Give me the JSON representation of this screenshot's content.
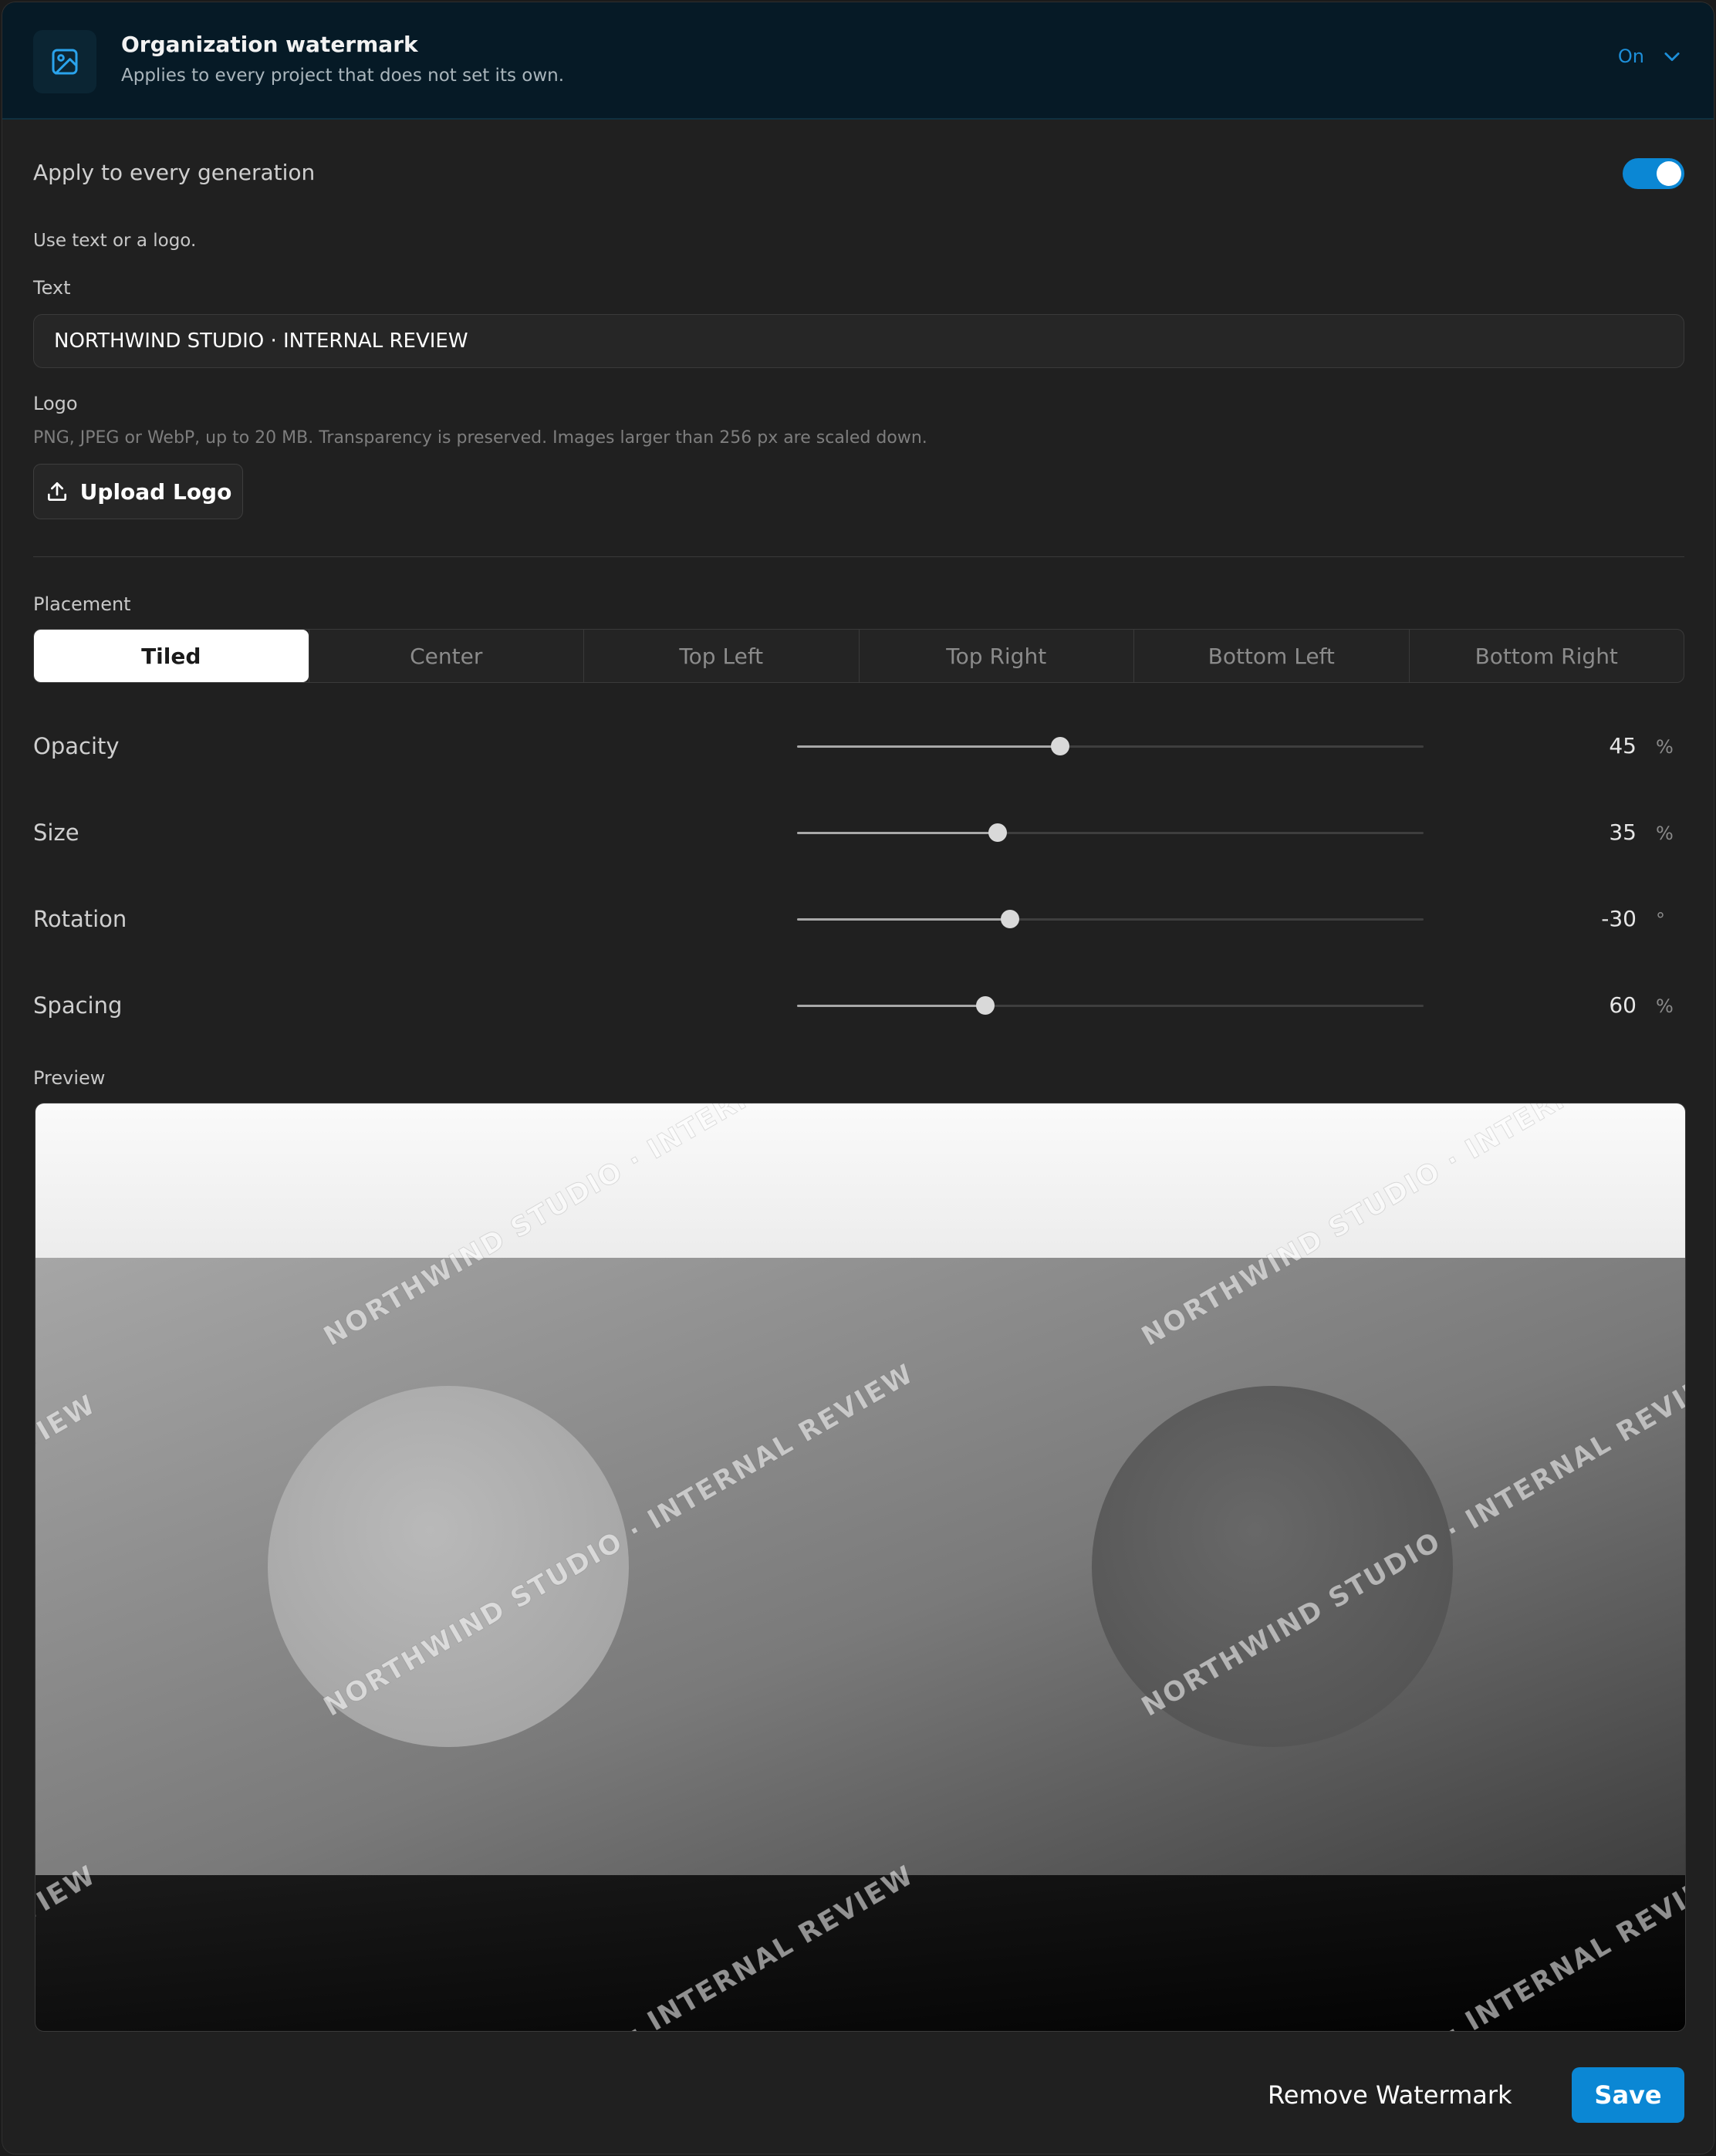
{
  "header": {
    "title": "Organization watermark",
    "subtitle": "Applies to every project that does not set its own.",
    "state": "On",
    "icon": "image-icon",
    "accent": "#0b87d4"
  },
  "apply_all": {
    "label": "Apply to every generation",
    "enabled": true
  },
  "hint": "Use text or a logo.",
  "text_field": {
    "label": "Text",
    "value": "NORTHWIND STUDIO · INTERNAL REVIEW"
  },
  "logo": {
    "label": "Logo",
    "help": "PNG, JPEG or WebP, up to 20 MB. Transparency is preserved. Images larger than 256 px are scaled down.",
    "upload_label": "Upload Logo"
  },
  "placement": {
    "label": "Placement",
    "options": [
      "Tiled",
      "Center",
      "Top Left",
      "Top Right",
      "Bottom Left",
      "Bottom Right"
    ],
    "selected": "Tiled"
  },
  "sliders": [
    {
      "label": "Opacity",
      "value": "45",
      "unit": "%",
      "fraction": 0.42
    },
    {
      "label": "Size",
      "value": "35",
      "unit": "%",
      "fraction": 0.32
    },
    {
      "label": "Rotation",
      "value": "-30",
      "unit": "°",
      "fraction": 0.34
    },
    {
      "label": "Spacing",
      "value": "60",
      "unit": "%",
      "fraction": 0.3
    }
  ],
  "preview": {
    "label": "Preview",
    "watermark_text": "NORTHWIND STUDIO · INTERNAL REVIEW"
  },
  "actions": {
    "remove_label": "Remove Watermark",
    "save_label": "Save"
  }
}
